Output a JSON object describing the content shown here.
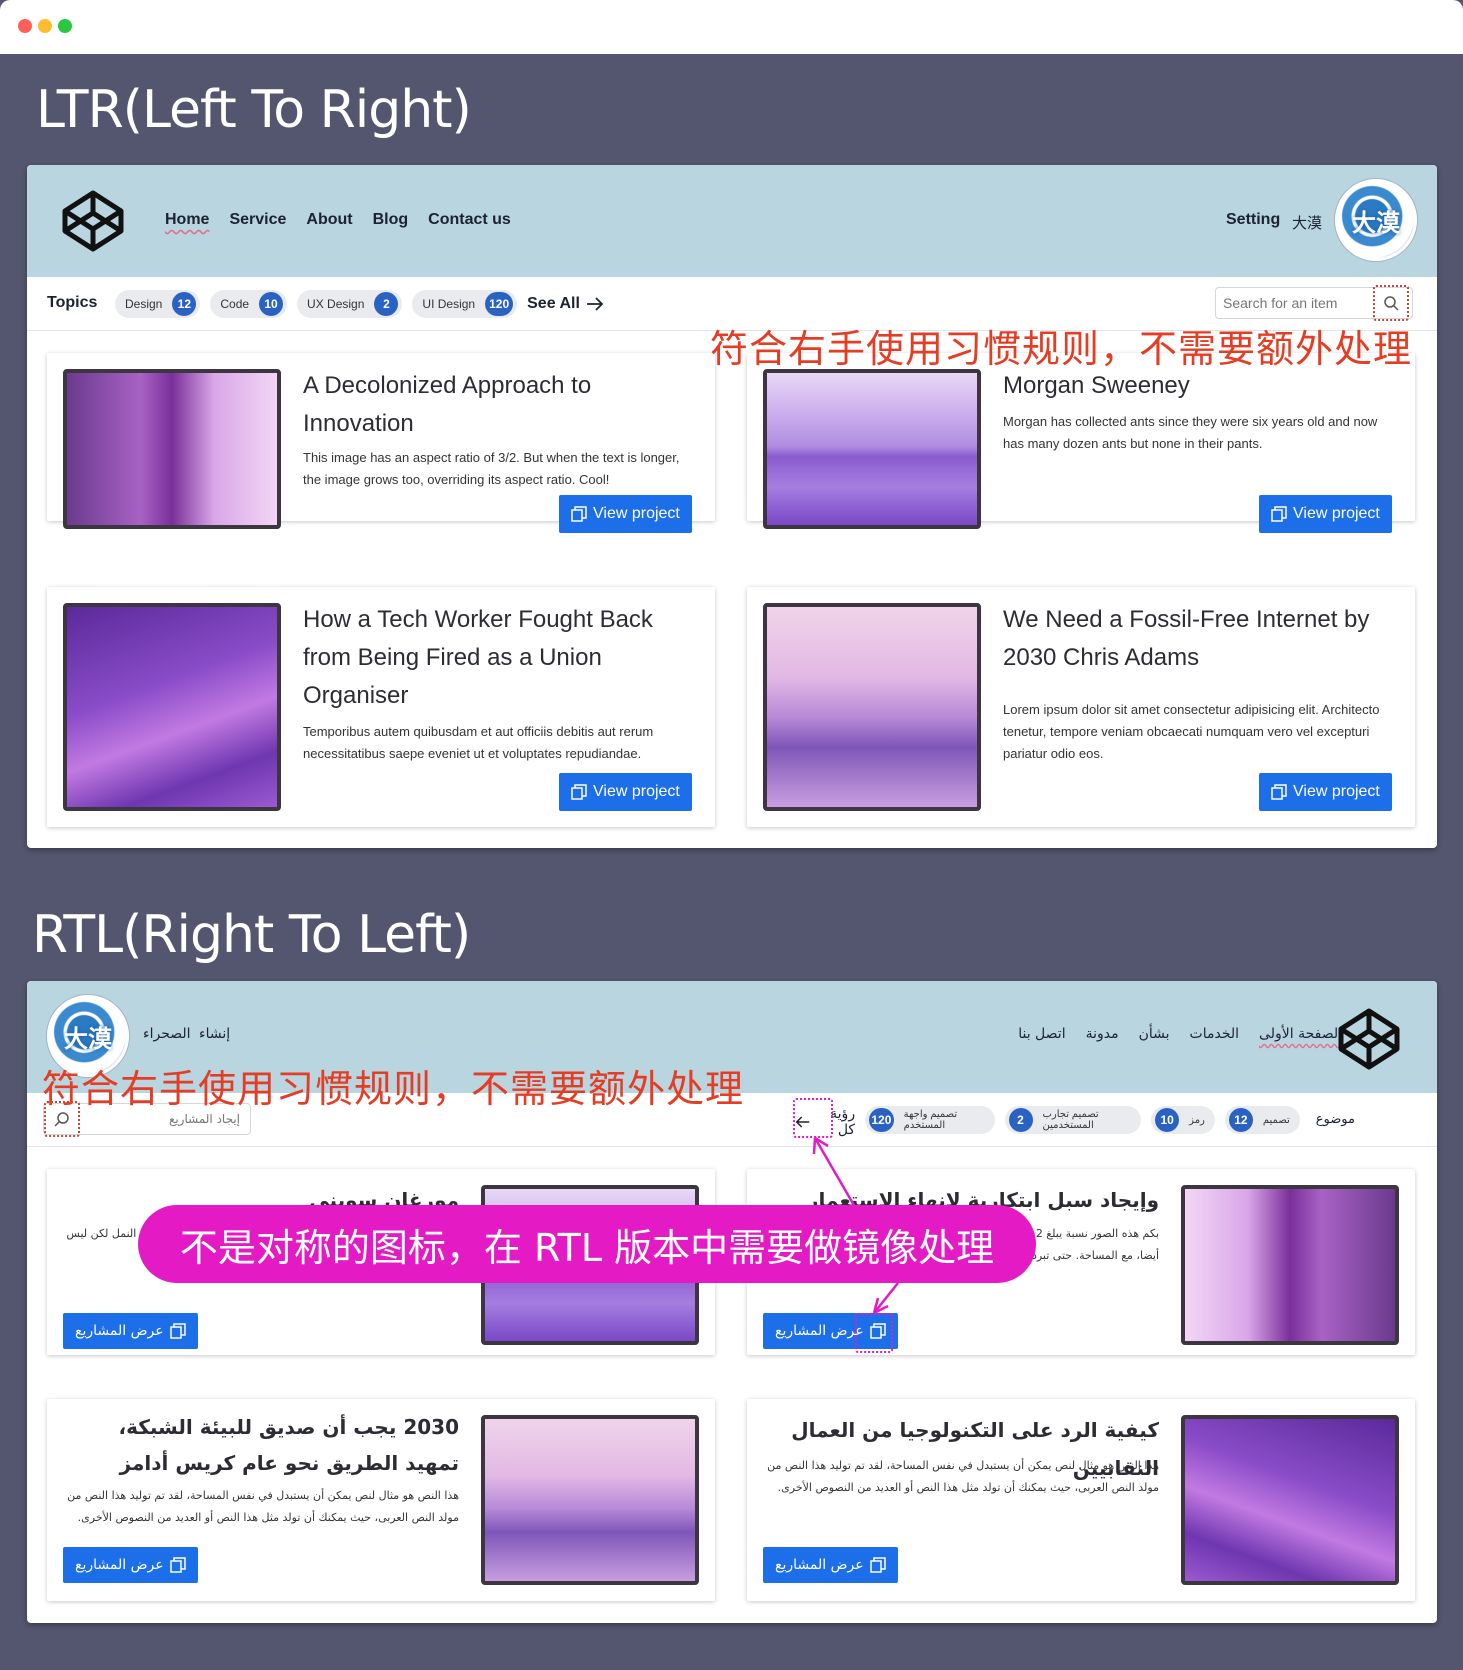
{
  "sections": {
    "ltr_title": "LTR(Left To Right)",
    "rtl_title": "RTL(Right To Left)"
  },
  "ltr": {
    "nav": [
      "Home",
      "Service",
      "About",
      "Blog",
      "Contact us"
    ],
    "setting": "Setting",
    "user_cjk": "大漠",
    "topics_label": "Topics",
    "chips": [
      {
        "label": "Design",
        "count": "12"
      },
      {
        "label": "Code",
        "count": "10"
      },
      {
        "label": "UX Design",
        "count": "2"
      },
      {
        "label": "UI Design",
        "count": "120"
      }
    ],
    "see_all": "See All",
    "search_placeholder": "Search for an item",
    "cards": [
      {
        "title": "A Decolonized Approach to Innovation",
        "desc": "This image has an aspect ratio of 3/2. But when the text is longer, the image grows too, overriding its aspect ratio. Cool!",
        "button": "View project"
      },
      {
        "title": "Morgan Sweeney",
        "desc": "Morgan has collected ants since they were six years old and now has many dozen ants but none in their pants.",
        "button": "View project"
      },
      {
        "title": "How a Tech Worker Fought Back from Being Fired as a Union Organiser",
        "desc": "Temporibus autem quibusdam et aut officiis debitis aut rerum necessitatibus saepe eveniet ut et voluptates repudiandae.",
        "button": "View project"
      },
      {
        "title": "We Need a Fossil-Free Internet by 2030 Chris Adams",
        "desc": "Lorem ipsum dolor sit amet consectetur adipisicing elit. Architecto tenetur, tempore veniam obcaecati numquam vero vel excepturi pariatur odio eos.",
        "button": "View project"
      }
    ]
  },
  "rtl": {
    "nav": [
      "الصفحة الأولى",
      "الخدمات",
      "بشأن",
      "مدونة",
      "اتصل بنا"
    ],
    "setting": "إنشاء",
    "user_label": "الصحراء",
    "user_cjk": "大漠",
    "topics_label": "موضوع",
    "chips": [
      {
        "label": "تصميم",
        "count": "12"
      },
      {
        "label": "رمز",
        "count": "10"
      },
      {
        "label": "تصميم تجارب المستخدمين",
        "count": "2"
      },
      {
        "label": "تصميم واجهة المستخدم",
        "count": "120"
      }
    ],
    "see_all": "رؤية كل",
    "search_placeholder": "إيجاد المشاريع",
    "cards": [
      {
        "title": "وإيجاد سبل ابتكارية لإنهاء الاستعمار",
        "desc": "بكم هذه الصور نسبة يبلغ 2 أيار/مارس. ولكن عندما يكون النص أطول، الصورة تنمو أيضا، مع المساحة. حتى تبرد!",
        "button": "عرض المشاريع"
      },
      {
        "title": "مورغان سويني",
        "desc": "جمع مورغان النمل منذ أن كان عمرهم ست سنوات والآن لديه عشرات النمل لكن ليس حول السراويل.",
        "button": "عرض المشاريع"
      },
      {
        "title": "كيفية الرد على التكنولوجيا من العمال النقابيين",
        "desc": "هذا النص هو مثال لنص يمكن أن يستبدل في نفس المساحة، لقد تم توليد هذا النص من مولد النص العربى، حيث يمكنك أن تولد مثل هذا النص أو العديد من النصوص الأخرى.",
        "button": "عرض المشاريع"
      },
      {
        "title": "2030 يجب أن صديق للبيئة الشبكة، تمهيد الطريق نحو عام كريس أدامز",
        "desc": "هذا النص هو مثال لنص يمكن أن يستبدل في نفس المساحة، لقد تم توليد هذا النص من مولد النص العربى، حيث يمكنك أن تولد مثل هذا النص أو العديد من النصوص الأخرى.",
        "button": "عرض المشاريع"
      }
    ]
  },
  "annotations": {
    "no_extra_handling": "符合右手使用习惯规则，不需要额外处理",
    "mirror_needed": "不是对称的图标，在 RTL 版本中需要做镜像处理"
  },
  "colors": {
    "background": "#54566f",
    "header": "#b9d5e0",
    "button": "#1c6fe8",
    "badge": "#2a62c4",
    "annotation_red": "#e53d24",
    "annotation_pink": "#e41bc4"
  },
  "icons": [
    "codepen-logo-icon",
    "search-icon",
    "arrow-right-icon",
    "arrow-left-icon",
    "copy-icon",
    "avatar-ink-icon"
  ]
}
